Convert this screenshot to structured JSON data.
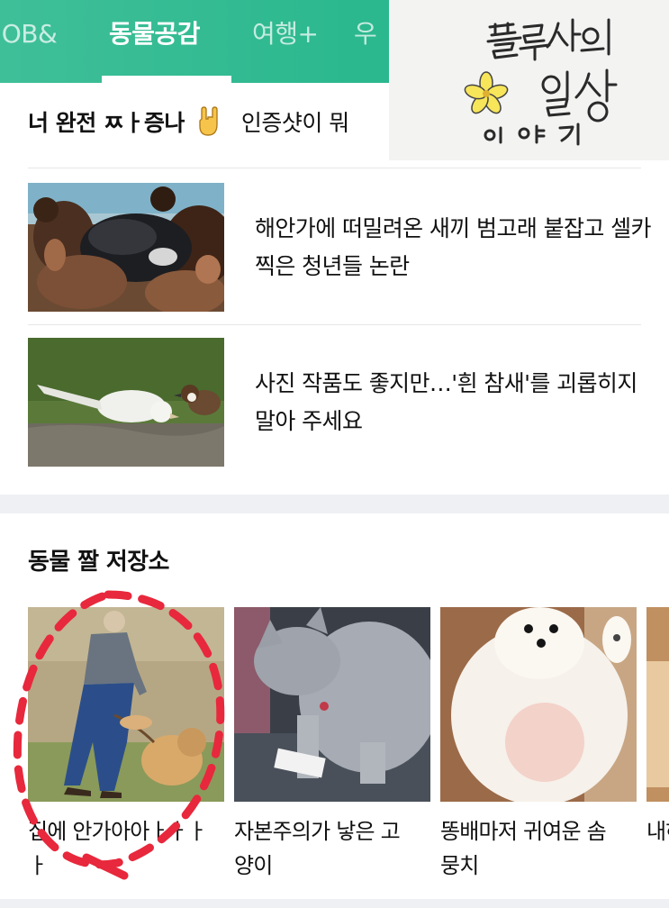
{
  "tabs": [
    {
      "label": "JOB&"
    },
    {
      "label": "동물공감",
      "active": true
    },
    {
      "label": "여행+"
    },
    {
      "label": "우"
    }
  ],
  "watermark": {
    "text": "플루사의 일상 이야기"
  },
  "tagline": {
    "tag1": "너 완전 ㅉㅏ증나",
    "tag2": "인증샷이 뭐"
  },
  "news": [
    {
      "title": "해안가에 떠밀려온 새끼 범고래 붙잡고 셀카 찍은 청년들 논란",
      "thumb": "people-with-baby-orca-photo"
    },
    {
      "title": "사진 작품도 좋지만…'흰 참새'를 괴롭히지 말아 주세요",
      "thumb": "white-sparrow-photo"
    }
  ],
  "section": {
    "title": "동물 짤 저장소"
  },
  "cards": [
    {
      "label": "집에 안가아아ㅏㅏㅏㅏ",
      "thumb": "man-dragging-dog-photo"
    },
    {
      "label": "자본주의가 낳은 고양이",
      "thumb": "gray-cat-photo"
    },
    {
      "label": "똥배마저 귀여운 솜뭉치",
      "thumb": "white-pomeranian-photo"
    },
    {
      "label": "내하",
      "thumb": "partial-photo"
    }
  ],
  "colors": {
    "tabbar": "#2bb88e",
    "annotation": "#e8283c",
    "divider": "#e7e7e7",
    "section_gap": "#eef0f4"
  }
}
